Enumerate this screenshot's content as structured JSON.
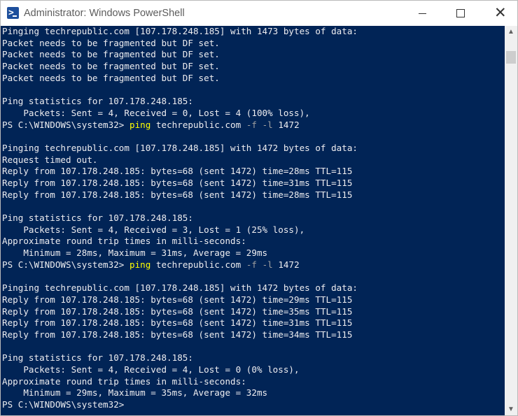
{
  "window": {
    "title": "Administrator: Windows PowerShell",
    "icon": "powershell-icon",
    "controls": {
      "minimize": "minimize-icon",
      "maximize": "maximize-icon",
      "close": "close-icon",
      "close_glyph": "✕"
    }
  },
  "colors": {
    "console_bg": "#012456",
    "console_text": "#eeedf0",
    "command": "#ffff00",
    "parameter": "#a0a0a0"
  },
  "console": {
    "lines": [
      {
        "text": "Pinging techrepublic.com [107.178.248.185] with 1473 bytes of data:"
      },
      {
        "text": "Packet needs to be fragmented but DF set."
      },
      {
        "text": "Packet needs to be fragmented but DF set."
      },
      {
        "text": "Packet needs to be fragmented but DF set."
      },
      {
        "text": "Packet needs to be fragmented but DF set."
      },
      {
        "text": ""
      },
      {
        "text": "Ping statistics for 107.178.248.185:"
      },
      {
        "text": "    Packets: Sent = 4, Received = 0, Lost = 4 (100% loss),"
      },
      {
        "prompt": "PS C:\\WINDOWS\\system32> ",
        "cmd": "ping",
        "mid": " techrepublic.com ",
        "flag1": "-f",
        "sp1": " ",
        "flag2": "-l",
        "rest": " 1472"
      },
      {
        "text": ""
      },
      {
        "text": "Pinging techrepublic.com [107.178.248.185] with 1472 bytes of data:"
      },
      {
        "text": "Request timed out."
      },
      {
        "text": "Reply from 107.178.248.185: bytes=68 (sent 1472) time=28ms TTL=115"
      },
      {
        "text": "Reply from 107.178.248.185: bytes=68 (sent 1472) time=31ms TTL=115"
      },
      {
        "text": "Reply from 107.178.248.185: bytes=68 (sent 1472) time=28ms TTL=115"
      },
      {
        "text": ""
      },
      {
        "text": "Ping statistics for 107.178.248.185:"
      },
      {
        "text": "    Packets: Sent = 4, Received = 3, Lost = 1 (25% loss),"
      },
      {
        "text": "Approximate round trip times in milli-seconds:"
      },
      {
        "text": "    Minimum = 28ms, Maximum = 31ms, Average = 29ms"
      },
      {
        "prompt": "PS C:\\WINDOWS\\system32> ",
        "cmd": "ping",
        "mid": " techrepublic.com ",
        "flag1": "-f",
        "sp1": " ",
        "flag2": "-l",
        "rest": " 1472"
      },
      {
        "text": ""
      },
      {
        "text": "Pinging techrepublic.com [107.178.248.185] with 1472 bytes of data:"
      },
      {
        "text": "Reply from 107.178.248.185: bytes=68 (sent 1472) time=29ms TTL=115"
      },
      {
        "text": "Reply from 107.178.248.185: bytes=68 (sent 1472) time=35ms TTL=115"
      },
      {
        "text": "Reply from 107.178.248.185: bytes=68 (sent 1472) time=31ms TTL=115"
      },
      {
        "text": "Reply from 107.178.248.185: bytes=68 (sent 1472) time=34ms TTL=115"
      },
      {
        "text": ""
      },
      {
        "text": "Ping statistics for 107.178.248.185:"
      },
      {
        "text": "    Packets: Sent = 4, Received = 4, Lost = 0 (0% loss),"
      },
      {
        "text": "Approximate round trip times in milli-seconds:"
      },
      {
        "text": "    Minimum = 29ms, Maximum = 35ms, Average = 32ms"
      },
      {
        "text": "PS C:\\WINDOWS\\system32>"
      }
    ]
  },
  "scrollbar": {
    "up_glyph": "▲",
    "down_glyph": "▼"
  }
}
